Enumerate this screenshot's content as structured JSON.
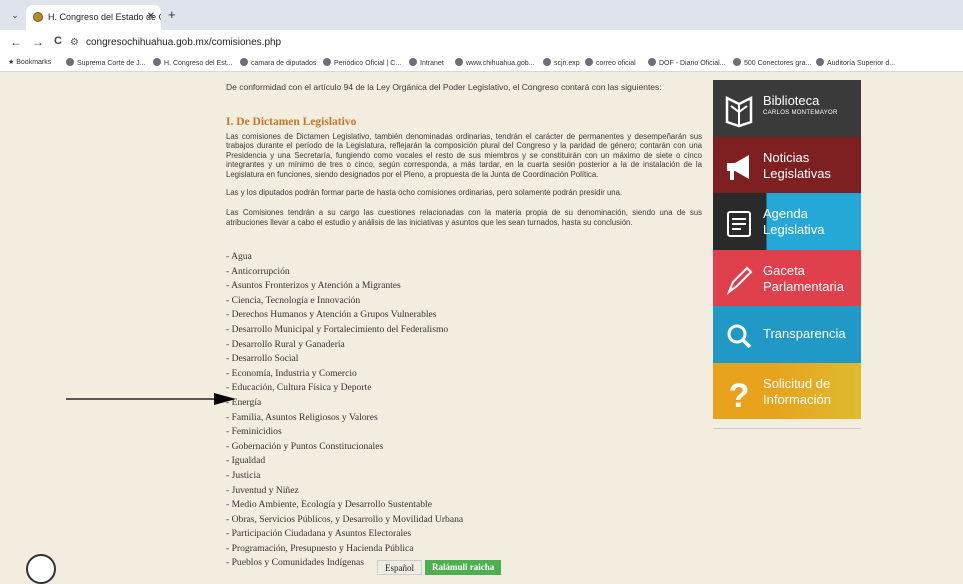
{
  "browser": {
    "tab_title": "H. Congreso del Estado de Chi",
    "close_glyph": "✕",
    "new_tab_glyph": "+",
    "menu_glyph": "⌄",
    "url": "congresochihuahua.gob.mx/comisiones.php",
    "nav": {
      "back": "←",
      "forward": "→",
      "reload": "C"
    },
    "bookmarks_label": "Bookmarks",
    "bookmarks": [
      "Suprema Corte de J...",
      "H. Congreso del Est...",
      "camara de diputados",
      "Periódico Oficial | C...",
      "Intranet",
      "www.chihuahua.gob...",
      "scjn.exp",
      "correo oficial",
      "DOF - Diario Oficial...",
      "500 Conectores gra...",
      "Auditoría Superior d..."
    ]
  },
  "main": {
    "intro": "De conformidad con el artículo 94 de la Ley Orgánica del Poder Legislativo, el Congreso contará con las siguientes:",
    "heading": "I. De Dictamen Legislativo",
    "para1": "Las comisiones de Dictamen Legislativo, también denominadas ordinarias, tendrán el carácter de permanentes y desempeñarán sus trabajos durante el período de la Legislatura, reflejarán la composición plural del Congreso y la paridad de género; contarán con una Presidencia y una Secretaría, fungiendo como vocales el resto de sus miembros y se constituirán con un máximo de siete o cinco integrantes y un mínimo de tres o cinco, según corresponda, a más tardar, en la cuarta sesión posterior a la de instalación de la Legislatura en funciones, siendo designados por el Pleno, a propuesta de la Junta de Coordinación Política.",
    "para2": "Las y los diputados podrán formar parte de hasta ocho comisiones ordinarias, pero solamente podrán presidir una.",
    "para3": "Las Comisiones tendrán a su cargo las cuestiones relacionadas con la materia propia de su denominación, siendo una de sus atribuciones llevar a cabo el estudio y análisis de las iniciativas y asuntos que les sean turnados, hasta su conclusión.",
    "commissions": [
      "- Agua",
      "- Anticorrupción",
      "- Asuntos Fronterizos y Atención a Migrantes",
      "- Ciencia, Tecnología e Innovación",
      "- Derechos Humanos y Atención a Grupos Vulnerables",
      "- Desarrollo Municipal y Fortalecimiento del Federalismo",
      "- Desarrollo Rural y Ganadería",
      "- Desarrollo Social",
      "- Economía, Industria y Comercio",
      "- Educación, Cultura Física y Deporte",
      "- Energía",
      "- Familia, Asuntos Religiosos y Valores",
      "- Feminicidios",
      "- Gobernación y Puntos Constitucionales",
      "- Igualdad",
      "- Justicia",
      "- Juventud y Niñez",
      "- Medio Ambiente, Ecología y Desarrollo Sustentable",
      "- Obras, Servicios Públicos, y Desarrollo y Movilidad Urbana",
      "- Participación Ciudadana y Asuntos Electorales",
      "- Programación, Presupuesto y Hacienda Pública",
      "- Pueblos y Comunidades Indígenas"
    ],
    "lang_es": "Español",
    "lang_ra": "Ralámuli raicha"
  },
  "sidebar": [
    {
      "line1": "Biblioteca",
      "line2": "",
      "sub": "CARLOS MONTEMAYOR",
      "icon": "library-icon"
    },
    {
      "line1": "Noticias",
      "line2": "Legislativas",
      "sub": "",
      "icon": "megaphone-icon"
    },
    {
      "line1": "Agenda",
      "line2": "Legislativa",
      "sub": "",
      "icon": "agenda-icon"
    },
    {
      "line1": "Gaceta",
      "line2": "Parlamentaria",
      "sub": "",
      "icon": "pen-icon"
    },
    {
      "line1": "Transparencia",
      "line2": "",
      "sub": "",
      "icon": "search-icon"
    },
    {
      "line1": "Solicitud de",
      "line2": "Información",
      "sub": "",
      "icon": "question-icon"
    }
  ],
  "colors": {
    "page_bg": "#f3eddf",
    "heading": "#c4762a",
    "noticias": "#7e1f22",
    "agenda": "#25a8d8",
    "gaceta": "#e0404c",
    "transparencia": "#2199c7",
    "solicitud": "#e9a21c"
  }
}
